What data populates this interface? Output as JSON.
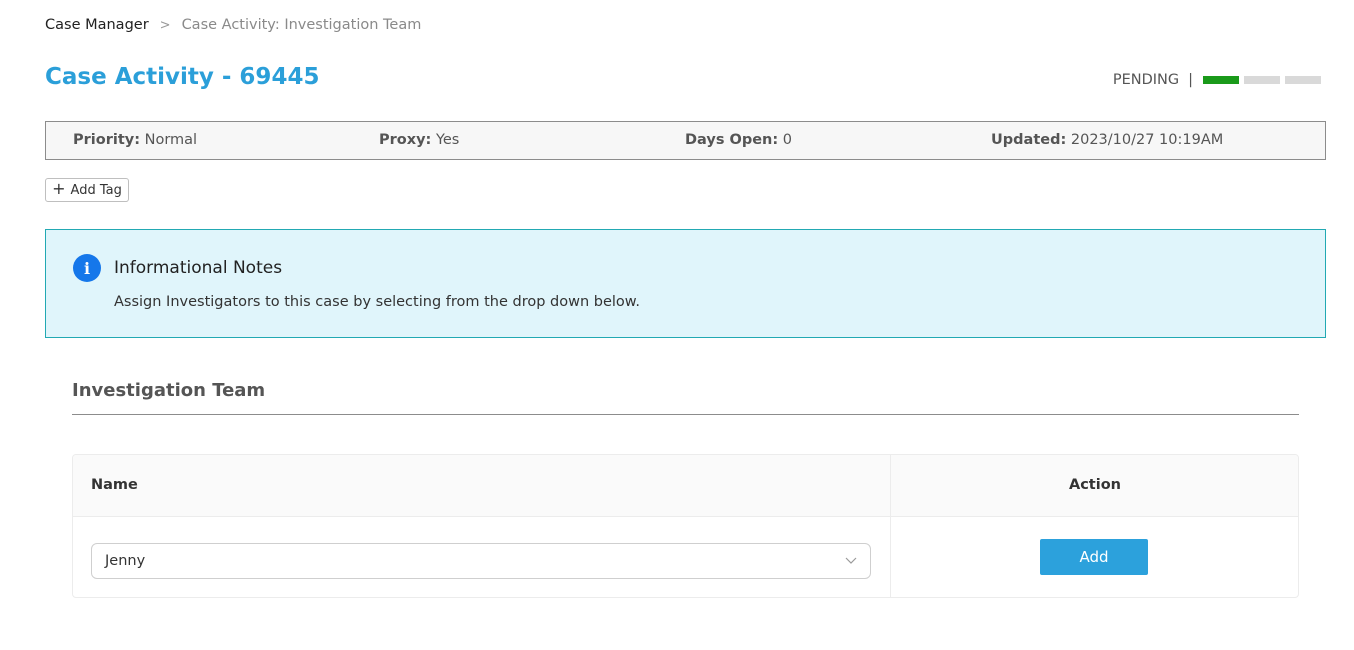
{
  "breadcrumb": {
    "root": "Case Manager",
    "separator": ">",
    "current": "Case Activity: Investigation Team"
  },
  "page": {
    "title": "Case Activity - 69445",
    "title_color": "#2b9fd9"
  },
  "status": {
    "label": "PENDING",
    "separator": "|",
    "steps_total": 3,
    "steps_completed": 1,
    "completed_color": "#1a9a1a"
  },
  "info_strip": {
    "priority": {
      "label": "Priority:",
      "value": "Normal"
    },
    "proxy": {
      "label": "Proxy:",
      "value": "Yes"
    },
    "days_open": {
      "label": "Days Open:",
      "value": "0"
    },
    "updated": {
      "label": "Updated:",
      "value": "2023/10/27 10:19AM"
    }
  },
  "add_tag": {
    "label": "Add Tag",
    "icon": "plus-icon"
  },
  "notes": {
    "icon": "info-icon",
    "title": "Informational Notes",
    "body": "Assign Investigators to this case by selecting from the drop down below.",
    "background": "#e0f5fb",
    "border": "#22a9b3"
  },
  "team": {
    "section_title": "Investigation Team",
    "columns": {
      "name": "Name",
      "action": "Action"
    },
    "row": {
      "selected_name": "Jenny",
      "action_label": "Add"
    },
    "accent": "#2ca1dc"
  }
}
